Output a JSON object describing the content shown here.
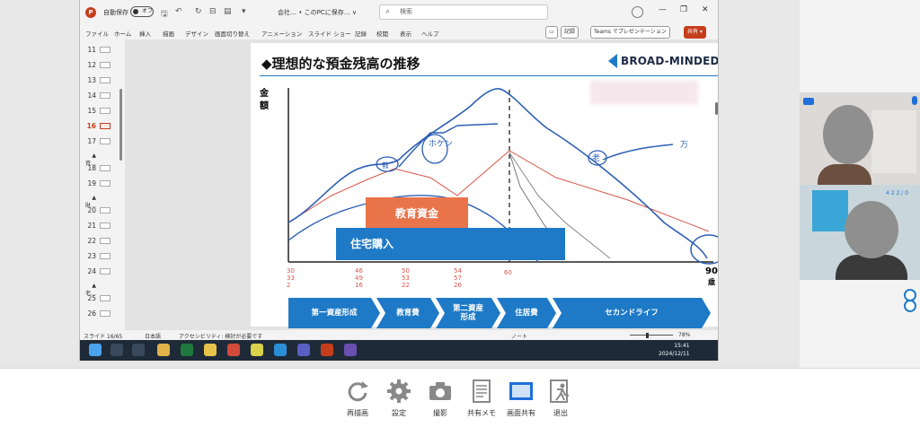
{
  "app": {
    "title_app_initial": "P",
    "autosave_label": "自動保存",
    "autosave_state": "オフ",
    "doc_name": "会社… • このPCに保存… ∨",
    "search_placeholder": "検索",
    "menu": [
      "ファイル",
      "ホーム",
      "挿入",
      "描画",
      "デザイン",
      "画面切り替え",
      "アニメーション",
      "スライド ショー",
      "記録",
      "校閲",
      "表示",
      "ヘルプ"
    ],
    "record_button": "記録",
    "teams_button": "Teams でプレゼンテーション",
    "share_button": "共有 ▾"
  },
  "thumbnails": [
    {
      "num": "11"
    },
    {
      "num": "12"
    },
    {
      "num": "13"
    },
    {
      "num": "14"
    },
    {
      "num": "15"
    },
    {
      "num": "16",
      "active": true
    },
    {
      "num": "17"
    },
    {
      "num": "▲ 資…",
      "section": true
    },
    {
      "num": "18"
    },
    {
      "num": "19"
    },
    {
      "num": "▲ 財…",
      "section": true
    },
    {
      "num": "20"
    },
    {
      "num": "21"
    },
    {
      "num": "22"
    },
    {
      "num": "23"
    },
    {
      "num": "24"
    },
    {
      "num": "▲ 老…",
      "section": true
    },
    {
      "num": "25"
    },
    {
      "num": "26"
    }
  ],
  "slide": {
    "heading": "◆理想的な預金残高の推移",
    "logo": "BROAD-MINDED",
    "ylabel": "金額",
    "xlabel_value": "90",
    "xlabel_unit": "歳",
    "edu_bar": "教育資金",
    "house_bar": "住宅購入",
    "phases": [
      "第一資産形成",
      "教育費",
      "第二資産\n形成",
      "住居費",
      "セカンドライフ"
    ],
    "annotations": {
      "tick_notes_1": "30\n33\n2",
      "tick_notes_2": "46\n49\n16",
      "tick_notes_3": "50\n53\n22",
      "tick_notes_4": "54\n57\n26",
      "tick_note_60": "60",
      "scribble_1": "ホケン",
      "scribble_2": "老",
      "scribble_3": "万",
      "scribble_4": "教"
    }
  },
  "statusbar": {
    "slide_info": "スライド 16/65",
    "language": "日本語",
    "accessibility": "アクセシビリティ: 検討が必要です",
    "notes": "ノート",
    "zoom": "78%"
  },
  "taskbar": {
    "time": "15:41",
    "date": "2024/12/11"
  },
  "participants": {
    "v2_text": "4 2 2 / 0"
  },
  "toolbar": [
    {
      "label": "再描画",
      "icon": "refresh-icon"
    },
    {
      "label": "設定",
      "icon": "gear-icon"
    },
    {
      "label": "撮影",
      "icon": "camera-icon"
    },
    {
      "label": "共有メモ",
      "icon": "memo-icon"
    },
    {
      "label": "画面共有",
      "icon": "screen-share-icon"
    },
    {
      "label": "退出",
      "icon": "exit-icon"
    }
  ],
  "colors": {
    "accent_blue": "#1e7ac7",
    "edu_orange": "#e9744a",
    "ppt_red": "#c43e1c"
  }
}
